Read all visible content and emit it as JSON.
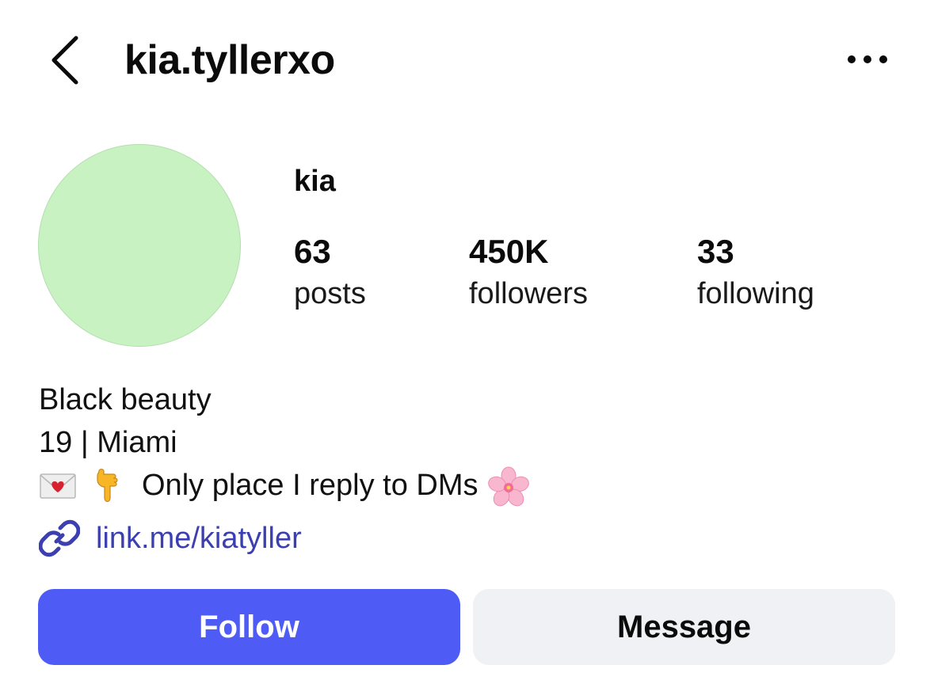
{
  "header": {
    "username": "kia.tyllerxo",
    "back_icon": "chevron-left-icon",
    "more_icon": "more-horizontal-icon"
  },
  "profile": {
    "avatar_color": "#c9f2c3",
    "display_name": "kia",
    "stats": [
      {
        "value": "63",
        "label": "posts"
      },
      {
        "value": "450K",
        "label": "followers"
      },
      {
        "value": "33",
        "label": "following"
      }
    ]
  },
  "bio": {
    "line1": "Black beauty",
    "line2": "19 | Miami",
    "line3_text": "Only place I reply to DMs",
    "line3_icons": [
      "love-letter-icon",
      "pointing-down-icon",
      "cherry-blossom-icon"
    ]
  },
  "link": {
    "icon": "link-icon",
    "text": "link.me/kiatyller",
    "color": "#3b3fb0"
  },
  "actions": {
    "follow_label": "Follow",
    "message_label": "Message",
    "follow_color": "#4f5bf5",
    "message_color": "#eff1f4"
  }
}
